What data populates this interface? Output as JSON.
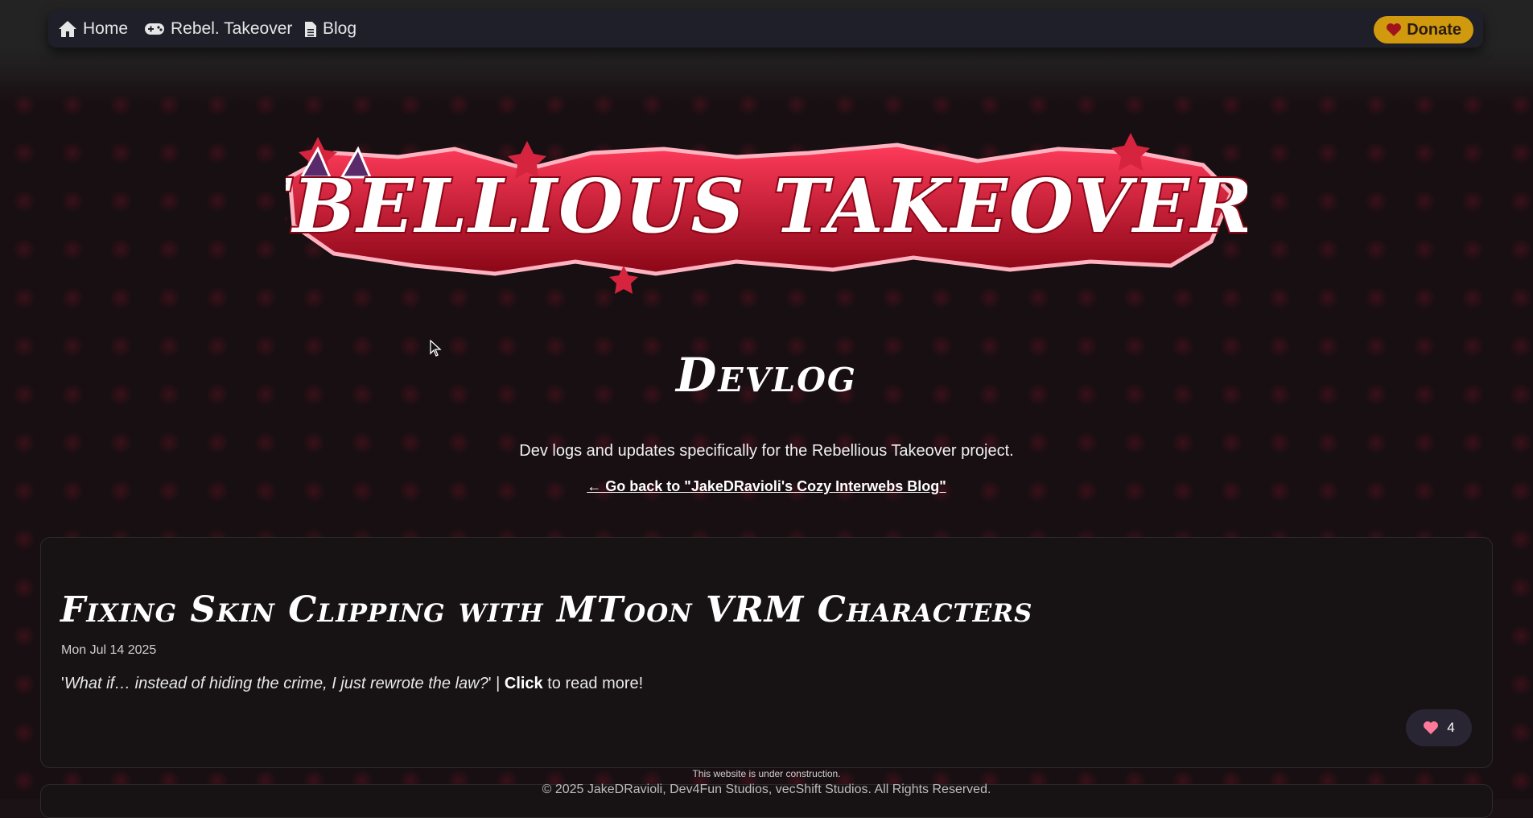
{
  "nav": {
    "items": [
      {
        "label": "Home",
        "icon": "home-icon"
      },
      {
        "label": "Rebel. Takeover",
        "icon": "gamepad-icon"
      },
      {
        "label": "Blog",
        "icon": "document-icon"
      }
    ],
    "donate_label": "Donate",
    "donate_icon": "heart-icon"
  },
  "banner": {
    "logo_text": "REBELLIOUS TAKEOVER!?"
  },
  "header": {
    "title": "Devlog",
    "subtitle": "Dev logs and updates specifically for the Rebellious Takeover project.",
    "back_link": "← Go back to \"JakeDRavioli's Cozy Interwebs Blog\""
  },
  "posts": [
    {
      "title": "Fixing Skin Clipping with MToon VRM Characters",
      "date": "Mon Jul 14 2025",
      "excerpt_open": "'",
      "excerpt_quote": "What if… instead of hiding the crime, I just rewrote the law?",
      "excerpt_close": "' | ",
      "excerpt_click": "Click",
      "excerpt_tail": " to read more!",
      "likes": "4"
    }
  ],
  "footer": {
    "construction": "This website is under construction.",
    "copyright": "© 2025 JakeDRavioli, Dev4Fun Studios, vecShift Studios. All Rights Reserved."
  },
  "colors": {
    "accent_red": "#d6243f",
    "donate_gold": "#d19a0e",
    "like_pink": "#ff7a9a"
  }
}
